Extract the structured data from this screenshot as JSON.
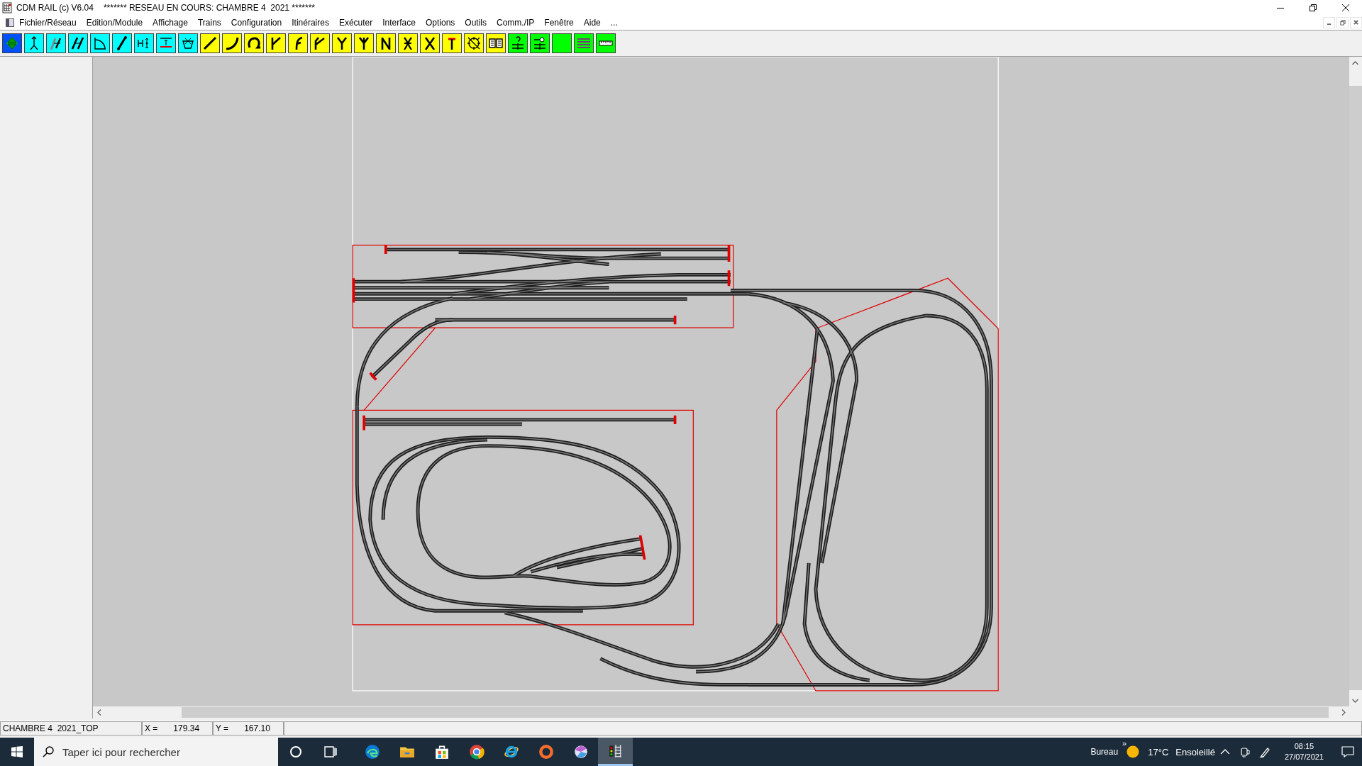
{
  "window": {
    "app_title": "CDM RAIL (c) V6.04",
    "document_title": "******* RESEAU EN COURS: CHAMBRE 4  2021 *******"
  },
  "menu": [
    "Fichier/Réseau",
    "Edition/Module",
    "Affichage",
    "Trains",
    "Configuration",
    "Itinéraires",
    "Exécuter",
    "Interface",
    "Options",
    "Outils",
    "Comm./IP",
    "Fenêtre",
    "Aide",
    "..."
  ],
  "toolbar": [
    {
      "color": "#0050ff"
    },
    {
      "color": "#00ffff"
    },
    {
      "color": "#00ffff"
    },
    {
      "color": "#00ffff"
    },
    {
      "color": "#00ffff"
    },
    {
      "color": "#00ffff"
    },
    {
      "color": "#00ffff"
    },
    {
      "color": "#00ffff"
    },
    {
      "color": "#00ffff"
    },
    {
      "color": "#ffff00"
    },
    {
      "color": "#ffff00"
    },
    {
      "color": "#ffff00"
    },
    {
      "color": "#ffff00"
    },
    {
      "color": "#ffff00"
    },
    {
      "color": "#ffff00"
    },
    {
      "color": "#ffff00"
    },
    {
      "color": "#ffff00"
    },
    {
      "color": "#ffff00"
    },
    {
      "color": "#ffff00"
    },
    {
      "color": "#ffff00"
    },
    {
      "color": "#ffff00"
    },
    {
      "color": "#ffff00"
    },
    {
      "color": "#ffff00"
    },
    {
      "color": "#00ff00"
    },
    {
      "color": "#00ff00"
    },
    {
      "color": "#00ff00"
    },
    {
      "color": "#00ff00"
    },
    {
      "color": "#00ff00"
    }
  ],
  "status_bar": {
    "network": "CHAMBRE 4  2021_TOP",
    "x_label": "X =",
    "x_value": "179.34",
    "y_label": "Y =",
    "y_value": "167.10"
  },
  "taskbar": {
    "search": {
      "placeholder": "Taper ici pour rechercher"
    },
    "apps": [
      {
        "selected": false
      },
      {
        "selected": false
      },
      {
        "selected": false
      },
      {
        "selected": false
      },
      {
        "selected": false
      },
      {
        "selected": false
      },
      {
        "selected": false
      },
      {
        "selected": true
      }
    ],
    "desktop_label": "Bureau",
    "more": "»",
    "temperature": "17°C",
    "weather": "Ensoleillé",
    "time": "08:15",
    "date": "27/07/2021"
  }
}
